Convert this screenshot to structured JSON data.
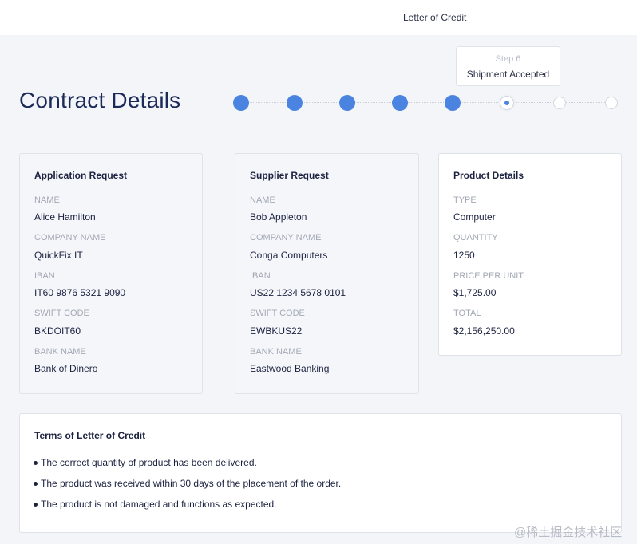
{
  "header": {
    "title": "Letter of Credit"
  },
  "page": {
    "title": "Contract Details"
  },
  "stepper": {
    "total_steps": 8,
    "current_step": 6,
    "tooltip_step": "Step 6",
    "tooltip_label": "Shipment Accepted"
  },
  "cards": [
    {
      "title": "Application Request",
      "fields": [
        {
          "label": "NAME",
          "value": "Alice Hamilton"
        },
        {
          "label": "COMPANY NAME",
          "value": "QuickFix IT"
        },
        {
          "label": "IBAN",
          "value": "IT60 9876 5321 9090"
        },
        {
          "label": "SWIFT CODE",
          "value": "BKDOIT60"
        },
        {
          "label": "BANK NAME",
          "value": "Bank of Dinero"
        }
      ]
    },
    {
      "title": "Supplier Request",
      "fields": [
        {
          "label": "NAME",
          "value": "Bob Appleton"
        },
        {
          "label": "COMPANY NAME",
          "value": "Conga Computers"
        },
        {
          "label": "IBAN",
          "value": "US22 1234 5678 0101"
        },
        {
          "label": "SWIFT CODE",
          "value": "EWBKUS22"
        },
        {
          "label": "BANK NAME",
          "value": "Eastwood Banking"
        }
      ]
    },
    {
      "title": "Product Details",
      "fields": [
        {
          "label": "TYPE",
          "value": "Computer"
        },
        {
          "label": "QUANTITY",
          "value": "1250"
        },
        {
          "label": "PRICE PER UNIT",
          "value": "$1,725.00"
        },
        {
          "label": "TOTAL",
          "value": "$2,156,250.00"
        }
      ]
    }
  ],
  "terms": {
    "title": "Terms of Letter of Credit",
    "items": [
      "The correct quantity of product has been delivered.",
      "The product was received within 30 days of the placement of the order.",
      "The product is not damaged and functions as expected."
    ]
  },
  "watermark": "@稀土掘金技术社区",
  "colors": {
    "accent": "#4a84e0",
    "title": "#1c2a5a",
    "label": "#a3a8b4"
  }
}
